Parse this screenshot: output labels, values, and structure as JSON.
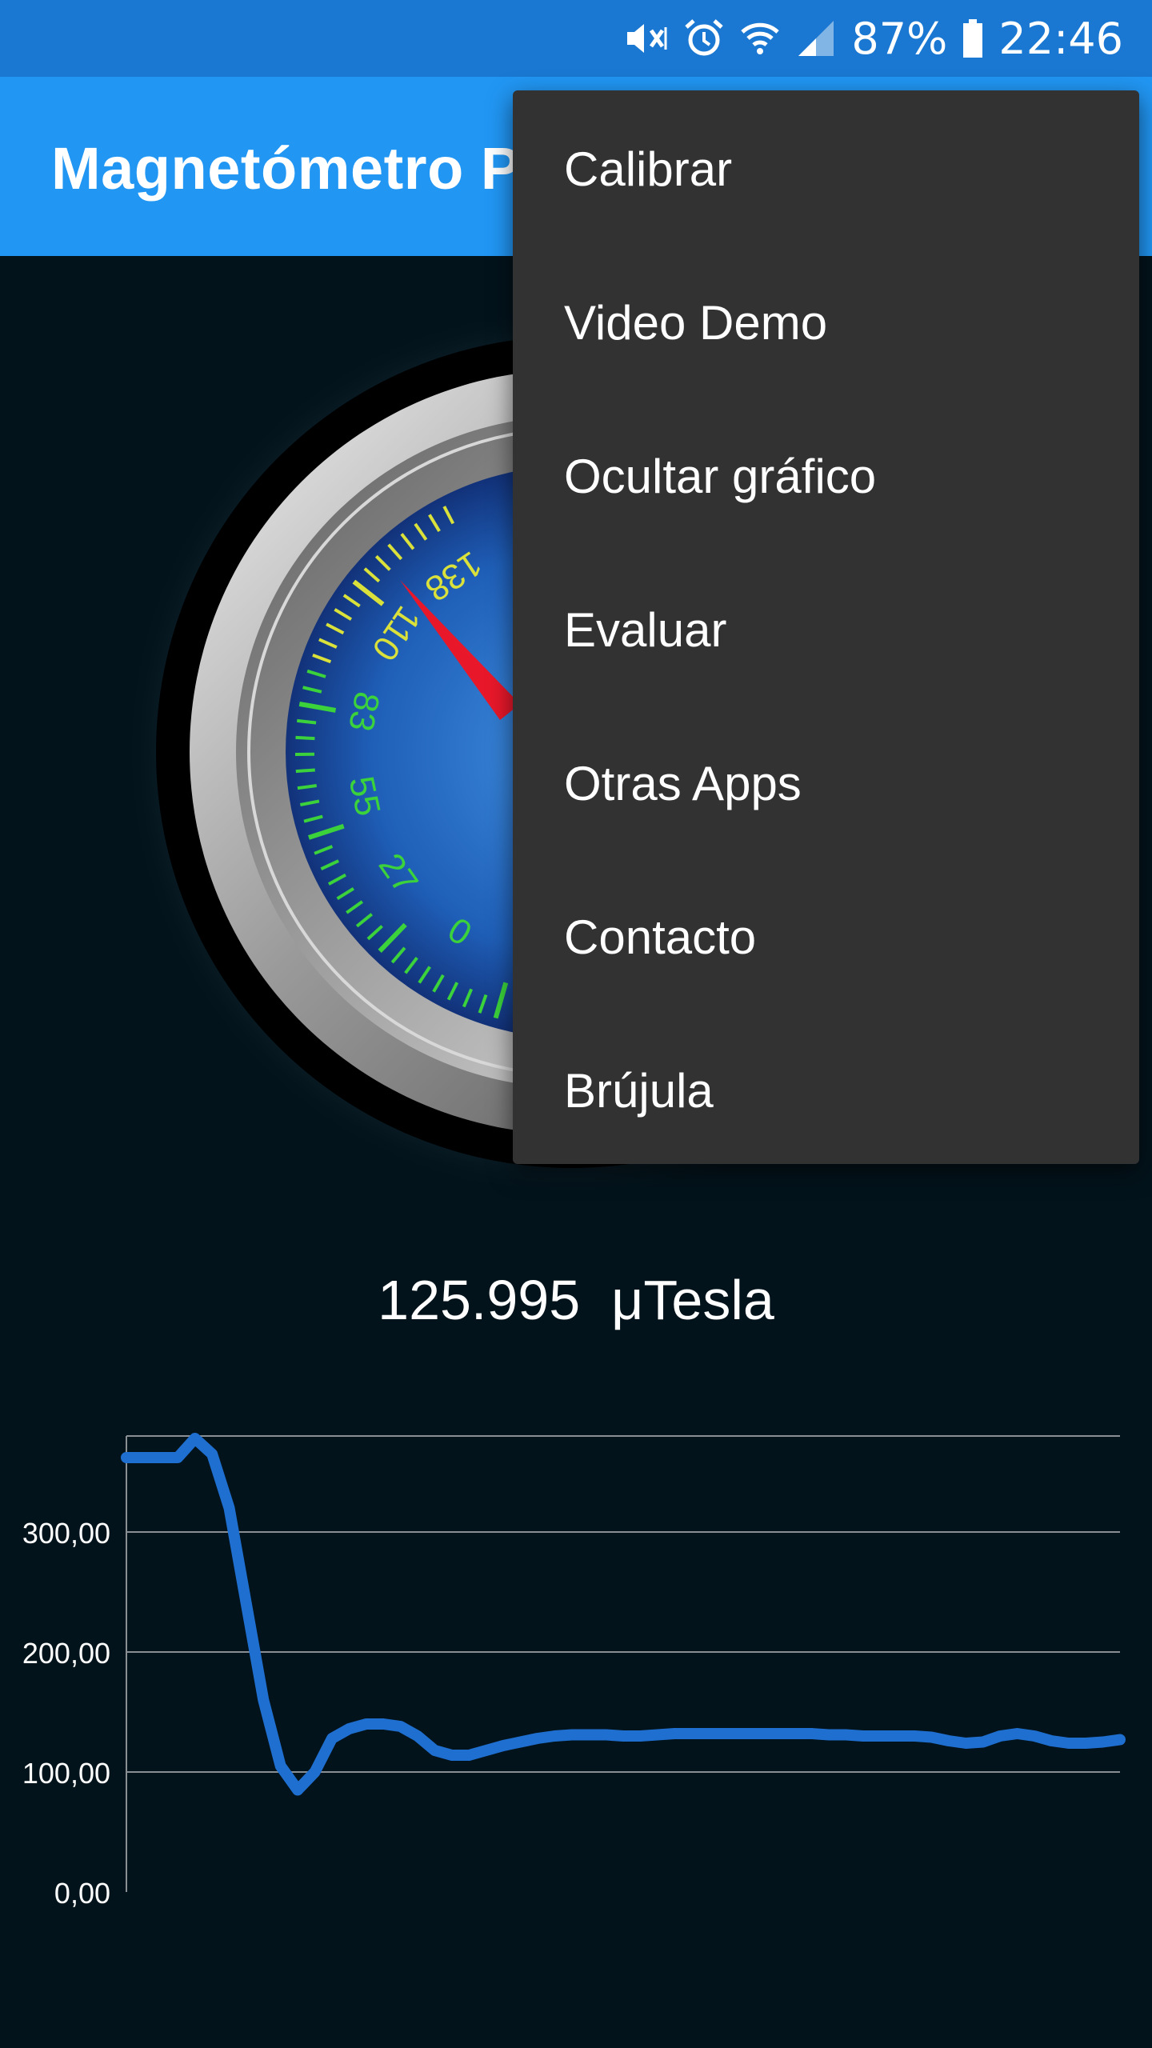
{
  "status_bar": {
    "icons": [
      "mute-vibrate-icon",
      "alarm-icon",
      "wifi-icon",
      "signal-icon",
      "battery-icon"
    ],
    "battery": "87%",
    "time": "22:46"
  },
  "app_bar": {
    "title": "Magnetómetro P"
  },
  "gauge": {
    "tick_labels": [
      "0",
      "27",
      "55",
      "83",
      "110",
      "138"
    ],
    "accent_green": "#3bd23b",
    "accent_yellow": "#d9e13a",
    "needle_color": "#e8182a",
    "dial_color": "#1f5fb8"
  },
  "reading": {
    "value": "125.995",
    "unit": "μTesla"
  },
  "menu": {
    "items": [
      {
        "label": "Calibrar"
      },
      {
        "label": "Video Demo"
      },
      {
        "label": "Ocultar gráfico"
      },
      {
        "label": "Evaluar"
      },
      {
        "label": "Otras Apps"
      },
      {
        "label": "Contacto"
      },
      {
        "label": "Brújula"
      }
    ]
  },
  "chart_data": {
    "type": "line",
    "title": "",
    "xlabel": "",
    "ylabel": "",
    "ylim": [
      0,
      380
    ],
    "y_ticks": [
      0,
      100,
      200,
      300
    ],
    "y_tick_labels": [
      "0,00",
      "100,00",
      "200,00",
      "300,00"
    ],
    "grid": true,
    "color": "#1f6fd1",
    "series": [
      {
        "values": [
          362,
          362,
          362,
          362,
          378,
          365,
          320,
          240,
          160,
          105,
          85,
          100,
          128,
          136,
          140,
          140,
          138,
          130,
          118,
          114,
          114,
          118,
          122,
          125,
          128,
          130,
          131,
          131,
          131,
          130,
          130,
          131,
          132,
          132,
          132,
          132,
          132,
          132,
          132,
          132,
          132,
          131,
          131,
          130,
          130,
          130,
          130,
          129,
          126,
          124,
          125,
          130,
          132,
          130,
          126,
          124,
          124,
          125,
          127
        ]
      }
    ]
  }
}
